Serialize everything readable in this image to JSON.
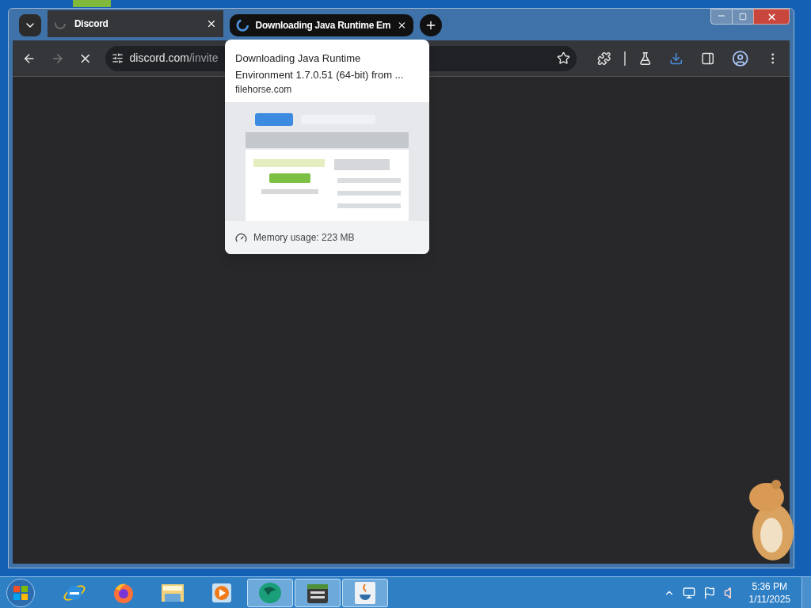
{
  "browser": {
    "tabs": [
      {
        "title": "Discord",
        "selected": false
      },
      {
        "title": "Downloading Java Runtime Em",
        "selected": true
      }
    ],
    "loading": true,
    "address": {
      "host": "discord.com",
      "path": "/invite"
    },
    "download_active": true
  },
  "hover_card": {
    "title": "Downloading Java Runtime Environment 1.7.0.51 (64-bit) from ...",
    "domain": "filehorse.com",
    "memory": "Memory usage: 223 MB"
  },
  "taskbar": {
    "apps": [
      {
        "kind": "ie",
        "active": false
      },
      {
        "kind": "firefox",
        "active": false
      },
      {
        "kind": "explorer",
        "active": false
      },
      {
        "kind": "media",
        "active": false
      },
      {
        "kind": "chrome",
        "active": true
      },
      {
        "kind": "game",
        "active": true
      },
      {
        "kind": "java",
        "active": true
      }
    ],
    "clock": {
      "time": "5:36 PM",
      "date": "1/11/2025"
    }
  }
}
